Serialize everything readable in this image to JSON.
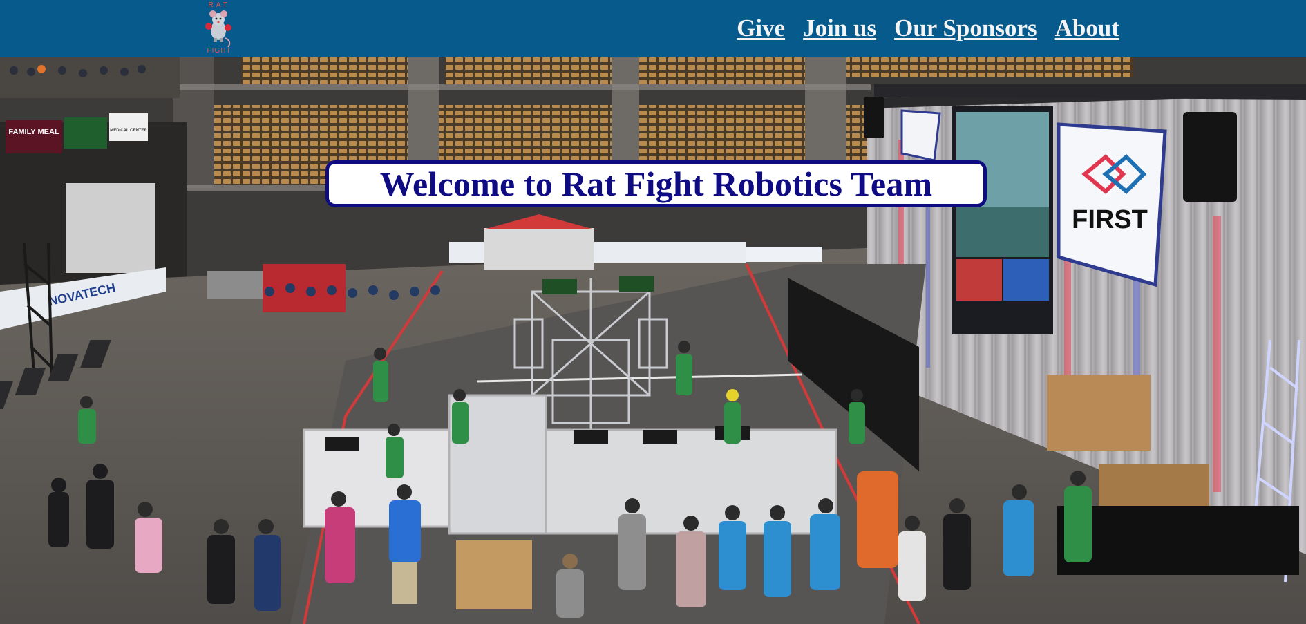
{
  "header": {
    "logo": {
      "icon": "rat-boxer-mascot-icon",
      "text_top": "RAT",
      "text_bottom": "FIGHT"
    },
    "nav": [
      {
        "label": "Give"
      },
      {
        "label": "Join us"
      },
      {
        "label": "Our Sponsors"
      },
      {
        "label": "About"
      }
    ]
  },
  "hero": {
    "welcome_title": "Welcome to Rat Fight Robotics Team",
    "arena_signs": {
      "family_meal": "FAMILY MEAL",
      "medical_center": "MEDICAL CENTER",
      "novatech": "NOVATECH",
      "first_banner": "FIRST"
    }
  },
  "colors": {
    "header_bg": "#075a8c",
    "nav_text": "#f4f4f4",
    "banner_border": "#0f0c82",
    "banner_text": "#0e0b83"
  }
}
